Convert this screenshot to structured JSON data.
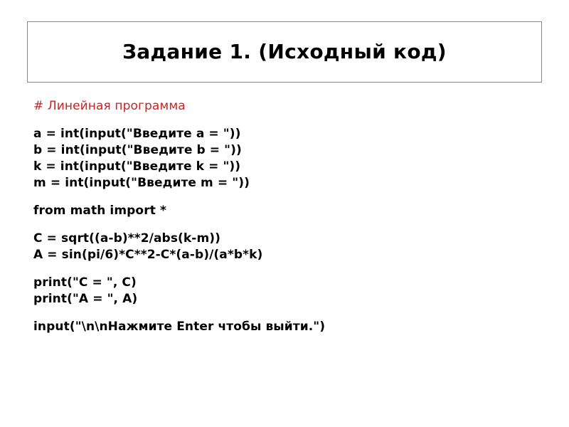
{
  "slide": {
    "title": "Задание 1. (Исходный код)",
    "colors": {
      "comment": "#CC2222",
      "code": "#000000",
      "background": "#FFFFFF",
      "title_border": "#888888"
    },
    "code_blocks": [
      {
        "name": "comment-block",
        "lines": [
          {
            "text": "# Линейная программа",
            "style": "comment"
          }
        ]
      },
      {
        "name": "input-block",
        "lines": [
          {
            "text": "a = int(input(\"Введите a = \"))",
            "style": "code"
          },
          {
            "text": "b = int(input(\"Введите b = \"))",
            "style": "code"
          },
          {
            "text": "k = int(input(\"Введите k = \"))",
            "style": "code"
          },
          {
            "text": "m = int(input(\"Введите m = \"))",
            "style": "code"
          }
        ]
      },
      {
        "name": "import-block",
        "lines": [
          {
            "text": "from math import *",
            "style": "code"
          }
        ]
      },
      {
        "name": "formula-block",
        "lines": [
          {
            "text": "C = sqrt((a-b)**2/abs(k-m))",
            "style": "code"
          },
          {
            "text": "A = sin(pi/6)*C**2-C*(a-b)/(a*b*k)",
            "style": "code"
          }
        ]
      },
      {
        "name": "print-block",
        "lines": [
          {
            "text": "print(\"C = \", C)",
            "style": "code"
          },
          {
            "text": "print(\"A = \", A)",
            "style": "code"
          }
        ]
      },
      {
        "name": "exit-block",
        "lines": [
          {
            "text": "input(\"\\n\\nНажмите Enter чтобы выйти.\")",
            "style": "code"
          }
        ]
      }
    ]
  }
}
